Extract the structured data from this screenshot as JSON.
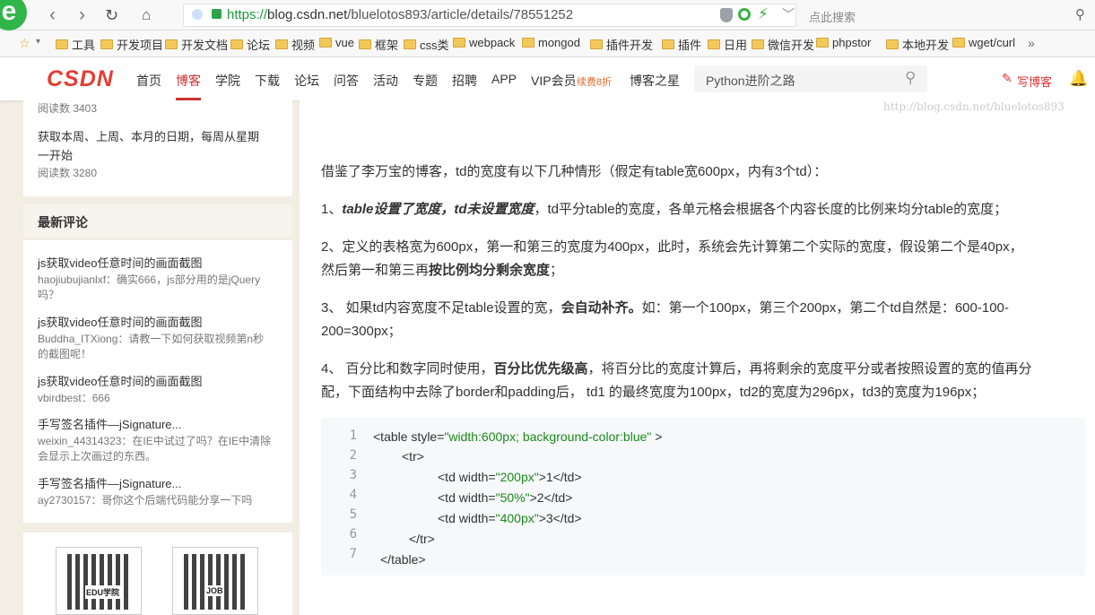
{
  "browser": {
    "url_prefix": "https://",
    "url_host": "blog.csdn.net",
    "url_path": "/bluelotos893/article/details/78551252",
    "search_placeholder": "点此搜索",
    "bookmarks": [
      "工具",
      "开发项目",
      "开发文档",
      "论坛",
      "视频",
      "vue",
      "框架",
      "css类",
      "webpack",
      "mongod",
      "插件开发",
      "插件",
      "日用",
      "微信开发",
      "phpstor",
      "本地开发",
      "wget/curl"
    ],
    "more": "»"
  },
  "csdn": {
    "logo": "CSDN",
    "nav": [
      "首页",
      "博客",
      "学院",
      "下载",
      "论坛",
      "问答",
      "活动",
      "专题",
      "招聘",
      "APP",
      "VIP会员"
    ],
    "vip_badge": "续费8折",
    "blog_star": "博客之星",
    "search_value": "Python进阶之路",
    "write_blog": "写博客"
  },
  "sidebar": {
    "prev_reads": "阅读数 3403",
    "article_title_1": "获取本周、上周、本月的日期，每周从星期",
    "article_title_2": "一开始",
    "article_reads": "阅读数 3280",
    "comments_heading": "最新评论",
    "comments": [
      {
        "title": "js获取video任意时间的画面截图",
        "line1": "haojiubujianlxf：确实666，js部分用的是jQuery",
        "line2": "吗？"
      },
      {
        "title": "js获取video任意时间的画面截图",
        "line1": "Buddha_ITXiong：请教一下如何获取视频第n秒",
        "line2": "的截图呢！"
      },
      {
        "title": "js获取video任意时间的画面截图",
        "line1": "vbirdbest：666",
        "line2": ""
      },
      {
        "title": "手写签名插件—jSignature...",
        "line1": "weixin_44314323：在IE中试过了吗？在IE中清除",
        "line2": "会显示上次画过的东西。"
      },
      {
        "title": "手写签名插件—jSignature...",
        "line1": "ay2730157：哥你这个后端代码能分享一下吗",
        "line2": ""
      }
    ],
    "qr_labels": [
      "EDU学院",
      "JOB"
    ]
  },
  "article": {
    "watermark": "http://blog.csdn.net/bluelotos893",
    "intro": "借鉴了李万宝的博客，td的宽度有以下几种情形（假定有table宽600px，内有3个td）：",
    "p1_num": "1、",
    "p1_bold": "table设置了宽度，td未设置宽度",
    "p1_rest": "，td平分table的宽度，各单元格会根据各个内容长度的比例来均分table的宽度；",
    "p2_line1": "2、定义的表格宽为600px，第一和第三的宽度为400px，此时，系统会先计算第二个实际的宽度，假设第二个是40px，",
    "p2_line2a": "然后第一和第三再",
    "p2_bold": "按比例均分剩余宽度",
    "p2_line2b": "；",
    "p3_a": "3、 如果td内容宽度不足table设置的宽，",
    "p3_bold": "会自动补齐。",
    "p3_b": "如：第一个100px，第三个200px，第二个td自然是：600-100-",
    "p3_line2": "200=300px；",
    "p4_a": "4、 百分比和数字同时使用，",
    "p4_bold": "百分比优先级高",
    "p4_b": "，将百分比的宽度计算后，再将剩余的宽度平分或者按照设置的宽的值再分",
    "p4_line2": "配，下面结构中去除了border和padding后， td1 的最终宽度为100px，td2的宽度为296px，td3的宽度为196px；",
    "code_lines": [
      "1",
      "2",
      "3",
      "4",
      "5",
      "6",
      "7"
    ],
    "code": {
      "l1a": "<table style=",
      "l1s": "\"width:600px; background-color:blue\"",
      "l1b": " >",
      "l2": "<tr>",
      "l3a": "<td width=",
      "l3s": "\"200px\"",
      "l3b": ">1</td>",
      "l4a": "<td width=",
      "l4s": "\"50%\"",
      "l4b": ">2</td>",
      "l5a": "<td width=",
      "l5s": "\"400px\"",
      "l5b": ">3</td>",
      "l6": "</tr>",
      "l7": "</table>"
    }
  }
}
